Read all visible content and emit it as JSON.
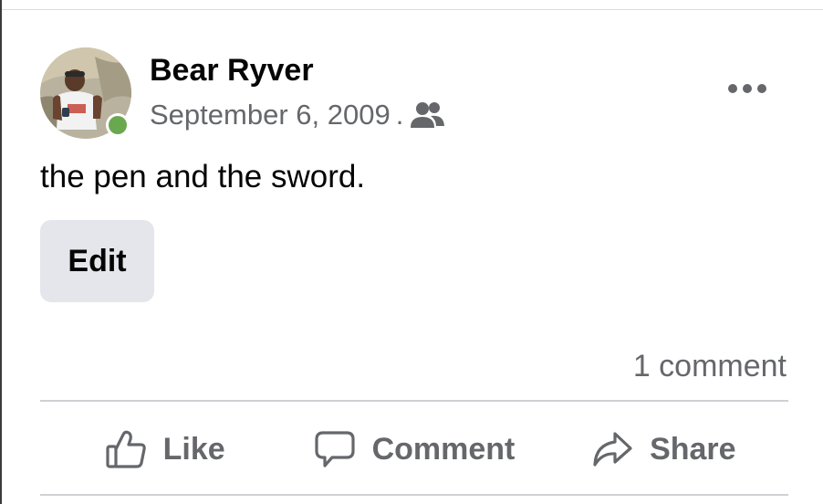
{
  "post": {
    "author": "Bear Ryver",
    "date": "September 6, 2009",
    "separator": ".",
    "audience_icon": "friends-icon",
    "text": "the pen and the sword.",
    "edit_label": "Edit",
    "comment_count": "1 comment",
    "online": true,
    "more_icon": "more-options-icon"
  },
  "actions": {
    "like": {
      "label": "Like",
      "icon": "thumbs-up-icon"
    },
    "comment": {
      "label": "Comment",
      "icon": "speech-bubble-icon"
    },
    "share": {
      "label": "Share",
      "icon": "share-arrow-icon"
    }
  },
  "colors": {
    "primary_text": "#050505",
    "secondary_text": "#65676b",
    "button_bg": "#e4e6eb",
    "divider": "#ced0d4",
    "online_green": "#6aa84f"
  }
}
